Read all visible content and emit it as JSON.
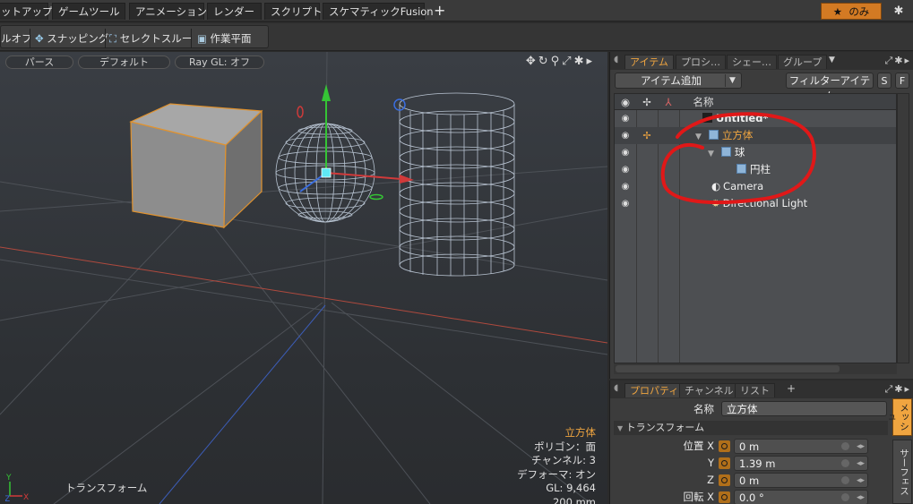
{
  "menu": {
    "tabs": [
      "ットアップ",
      "ゲームツール",
      "アニメーション",
      "レンダー",
      "スクリプト",
      "スケマティックFusion"
    ],
    "add_tab": "+",
    "layout_label": "のみ"
  },
  "toolbar": {
    "items": [
      "ルオフ",
      "スナッピング",
      "セレクトスルー",
      "作業平面"
    ]
  },
  "viewport": {
    "view_mode": "パース",
    "shading": "デフォルト",
    "raygl": "Ray GL: オフ",
    "status_label": "トランスフォーム",
    "info": {
      "selected": "立方体",
      "polygon": "ポリゴン：面",
      "channels": "チャンネル: 3",
      "deformer": "デフォーマ: オン",
      "gl": "GL: 9,464",
      "size": "200 mm"
    },
    "axis_labels": {
      "y": "Y",
      "x": "X",
      "z": "Z"
    },
    "colors": {
      "selection": "#f0a540",
      "y_axis": "#35c435",
      "x_axis": "#d13a3a",
      "z_axis": "#3a6ee0"
    }
  },
  "item_panel": {
    "tabs": [
      "アイテム",
      "プロシ…",
      "シェー…",
      "グループ"
    ],
    "active_tab": 0,
    "add_item": "アイテム追加",
    "filter": "フィルターアイテム",
    "s_btn": "S",
    "f_btn": "F",
    "name_header": "名称",
    "tree": [
      {
        "label": "Untitled*",
        "depth": 0,
        "icon": "scene-icon",
        "selected": false
      },
      {
        "label": "立方体",
        "depth": 1,
        "icon": "mesh-icon",
        "selected": true
      },
      {
        "label": "球",
        "depth": 2,
        "icon": "mesh-icon",
        "selected": false
      },
      {
        "label": "円柱",
        "depth": 3,
        "icon": "mesh-icon",
        "selected": false
      },
      {
        "label": "Camera",
        "depth": 1,
        "icon": "camera-icon",
        "selected": false
      },
      {
        "label": "Directional Light",
        "depth": 1,
        "icon": "light-icon",
        "selected": false
      }
    ]
  },
  "properties_panel": {
    "tabs": [
      "プロパティ",
      "チャンネル",
      "リスト"
    ],
    "add_tab": "+",
    "name_label": "名称",
    "name_value": "立方体",
    "section": "トランスフォーム",
    "position_label": "位置",
    "rotation_label": "回転",
    "rows": [
      {
        "axis": "X",
        "value": "0 m"
      },
      {
        "axis": "Y",
        "value": "1.39 m"
      },
      {
        "axis": "Z",
        "value": "0 m"
      }
    ],
    "rotation_x": "0.0 °",
    "side_tabs": [
      "メッシュ",
      "サーフェス"
    ]
  }
}
